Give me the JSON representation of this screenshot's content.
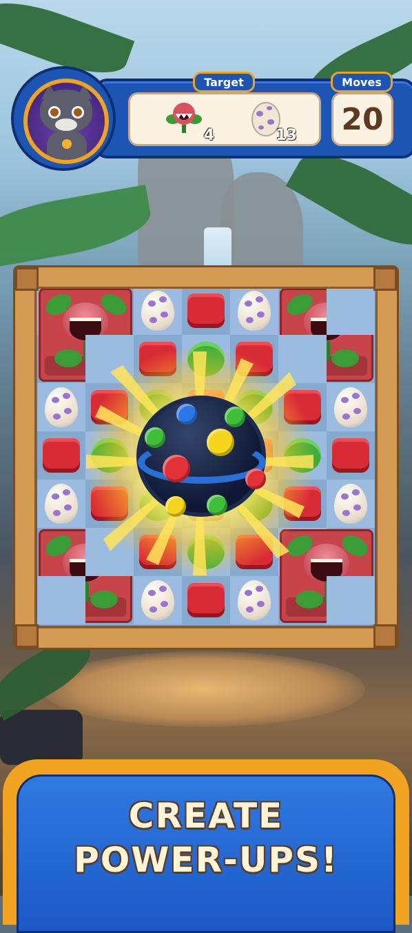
{
  "hud": {
    "target_label": "Target",
    "moves_label": "Moves",
    "moves_value": "20",
    "targets": [
      {
        "icon": "flytrap-plant-icon",
        "count": "4"
      },
      {
        "icon": "spotted-egg-icon",
        "count": "13"
      }
    ]
  },
  "banner": {
    "line1": "CREATE",
    "line2": "POWER-UPS!"
  },
  "colors": {
    "hud_blue": "#1d55b4",
    "accent_orange": "#f2a321",
    "tile_red": "#d92b35",
    "tile_green": "#3fae3a",
    "egg_spot": "#9a74cf",
    "banner_text": "#fff3d8"
  },
  "board": {
    "rows": 7,
    "cols": 7,
    "layout": [
      [
        "planter",
        "planter",
        "egg",
        "cloth",
        "egg",
        "planter",
        "planter"
      ],
      [
        "planter",
        "planter",
        "cloth",
        "leafy",
        "cloth",
        "planter",
        "planter"
      ],
      [
        "egg",
        "cloth",
        "leafy",
        "cloth",
        "leafy",
        "cloth",
        "egg"
      ],
      [
        "cloth",
        "leafy",
        "cloth",
        "egg",
        "cloth",
        "leafy",
        "cloth"
      ],
      [
        "egg",
        "cloth",
        "leafy",
        "cloth",
        "leafy",
        "cloth",
        "egg"
      ],
      [
        "planter",
        "planter",
        "cloth",
        "leafy",
        "cloth",
        "planter",
        "planter"
      ],
      [
        "planter",
        "planter",
        "egg",
        "cloth",
        "egg",
        "planter",
        "planter"
      ]
    ],
    "powerup": "color-bomb"
  }
}
